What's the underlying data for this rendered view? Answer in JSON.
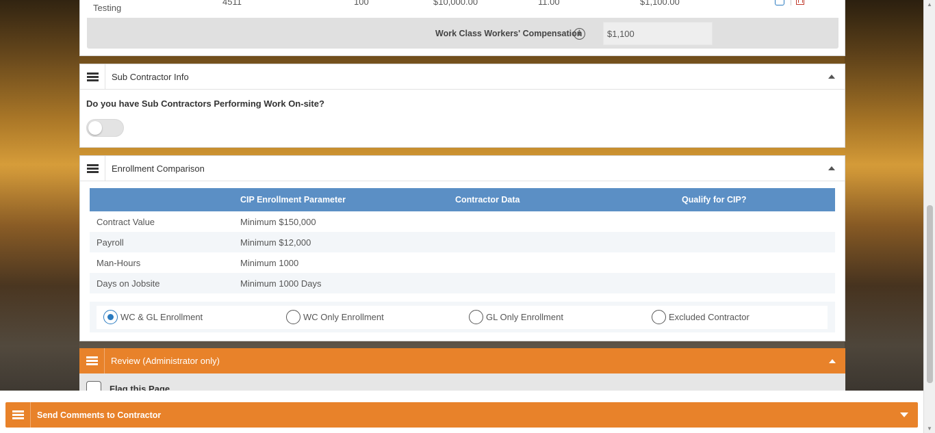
{
  "work_class_row": {
    "name": "Testing",
    "code": "4511",
    "percent": "100",
    "payroll": "$10,000.00",
    "rate": "11.00",
    "premium": "$1,100.00"
  },
  "work_class_comp": {
    "label": "Work Class Workers' Compensation",
    "value": "$1,100"
  },
  "sub_contractor": {
    "title": "Sub Contractor Info",
    "question": "Do you have Sub Contractors Performing Work On-site?",
    "toggle_on": false
  },
  "enrollment": {
    "title": "Enrollment Comparison",
    "columns": [
      "",
      "CIP Enrollment Parameter",
      "Contractor Data",
      "Qualify for CIP?"
    ],
    "rows": [
      {
        "label": "Contract Value",
        "param": "Minimum $150,000",
        "data": "",
        "qualify": ""
      },
      {
        "label": "Payroll",
        "param": "Minimum $12,000",
        "data": "",
        "qualify": ""
      },
      {
        "label": "Man-Hours",
        "param": "Minimum 1000",
        "data": "",
        "qualify": ""
      },
      {
        "label": "Days on Jobsite",
        "param": "Minimum 1000 Days",
        "data": "",
        "qualify": ""
      }
    ],
    "options": [
      {
        "label": "WC & GL Enrollment",
        "checked": true
      },
      {
        "label": "WC Only Enrollment",
        "checked": false
      },
      {
        "label": "GL Only Enrollment",
        "checked": false
      },
      {
        "label": "Excluded Contractor",
        "checked": false
      }
    ]
  },
  "review": {
    "title": "Review (Administrator only)",
    "flag_label": "Flag this Page"
  },
  "comments": {
    "title": "Send Comments to Contractor"
  },
  "colors": {
    "accent_orange": "#e8822a",
    "table_header": "#5b8fc5",
    "radio_selected": "#2a7bc0"
  }
}
